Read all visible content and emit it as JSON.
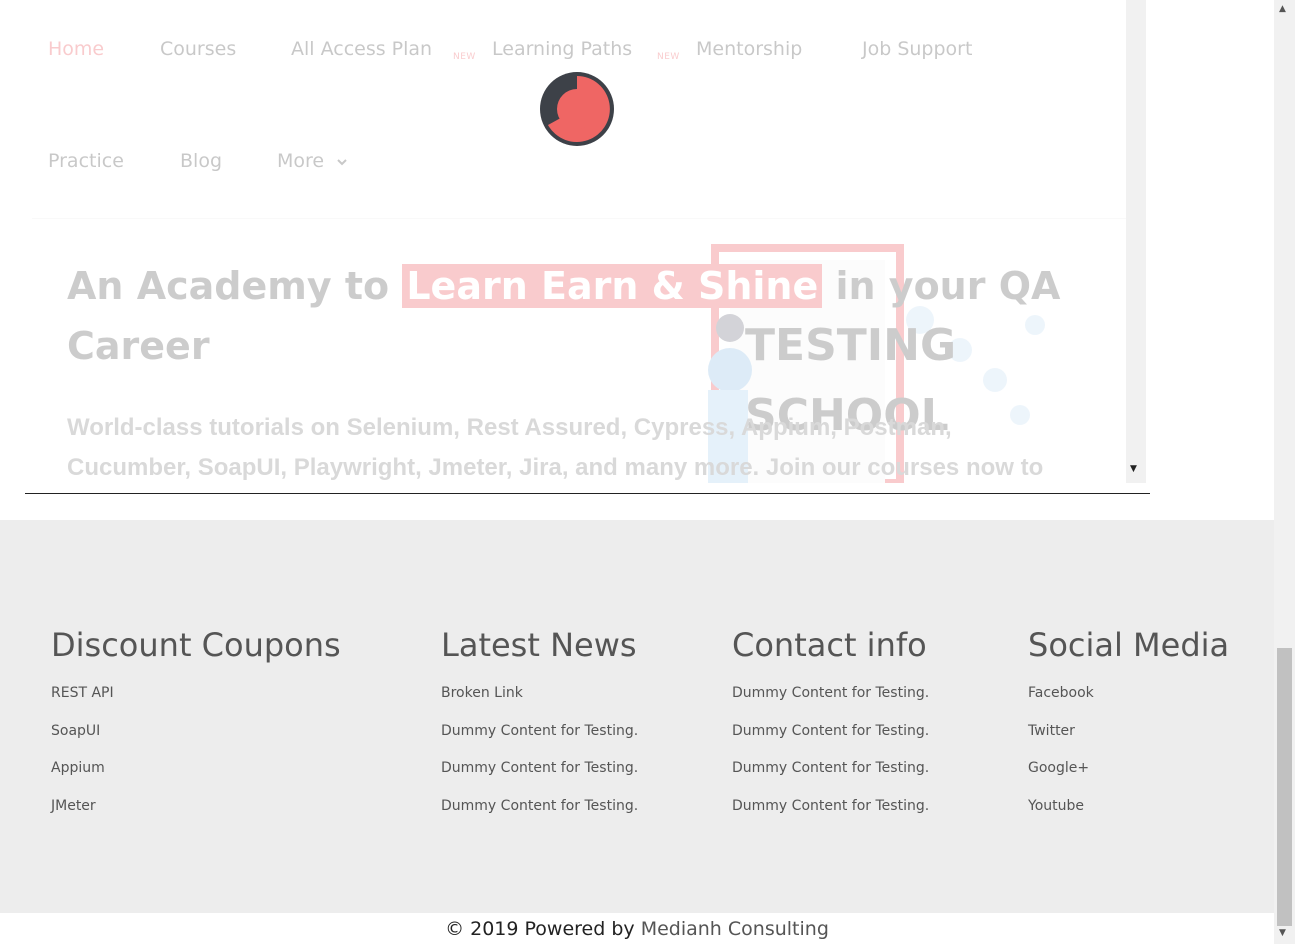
{
  "nav": {
    "items": [
      {
        "label": "Home"
      },
      {
        "label": "Courses"
      },
      {
        "label": "All Access Plan",
        "badge": "NEW"
      },
      {
        "label": "Learning Paths",
        "badge": "NEW"
      },
      {
        "label": "Mentorship"
      },
      {
        "label": "Job Support"
      },
      {
        "label": "Practice"
      },
      {
        "label": "Blog"
      },
      {
        "label": "More"
      }
    ]
  },
  "hero": {
    "title_start": "An Academy to ",
    "title_highlight": "Learn Earn & Shine",
    "title_end": " in your QA Career",
    "subtitle": "World-class tutorials on Selenium, Rest Assured, Cypress, Appium, Postman, Cucumber, SoapUI, Playwright, Jmeter, Jira, and many more. Join our courses now to get the best job",
    "illustration_text_1": "TESTING",
    "illustration_text_2": "SCHOOL"
  },
  "footer": {
    "columns": [
      {
        "title": "Discount Coupons",
        "links": [
          "REST API",
          "SoapUI",
          "Appium",
          "JMeter"
        ]
      },
      {
        "title": "Latest News",
        "links": [
          "Broken Link",
          "Dummy Content for Testing.",
          "Dummy Content for Testing.",
          "Dummy Content for Testing."
        ]
      },
      {
        "title": "Contact info",
        "links": [
          "Dummy Content for Testing.",
          "Dummy Content for Testing.",
          "Dummy Content for Testing.",
          "Dummy Content for Testing."
        ]
      },
      {
        "title": "Social Media",
        "links": [
          "Facebook",
          "Twitter",
          "Google+",
          "Youtube"
        ]
      }
    ],
    "copyright_prefix": "© 2019 Powered by ",
    "copyright_brand": "Medianh Consulting"
  },
  "colors": {
    "accent": "#e8353b",
    "footer_bg": "#ededed",
    "spinner_dark": "#3d4148",
    "spinner_red": "#ef6664"
  },
  "icons": {
    "more_dropdown": "chevron-down-icon",
    "loading": "loading-spinner-icon"
  }
}
